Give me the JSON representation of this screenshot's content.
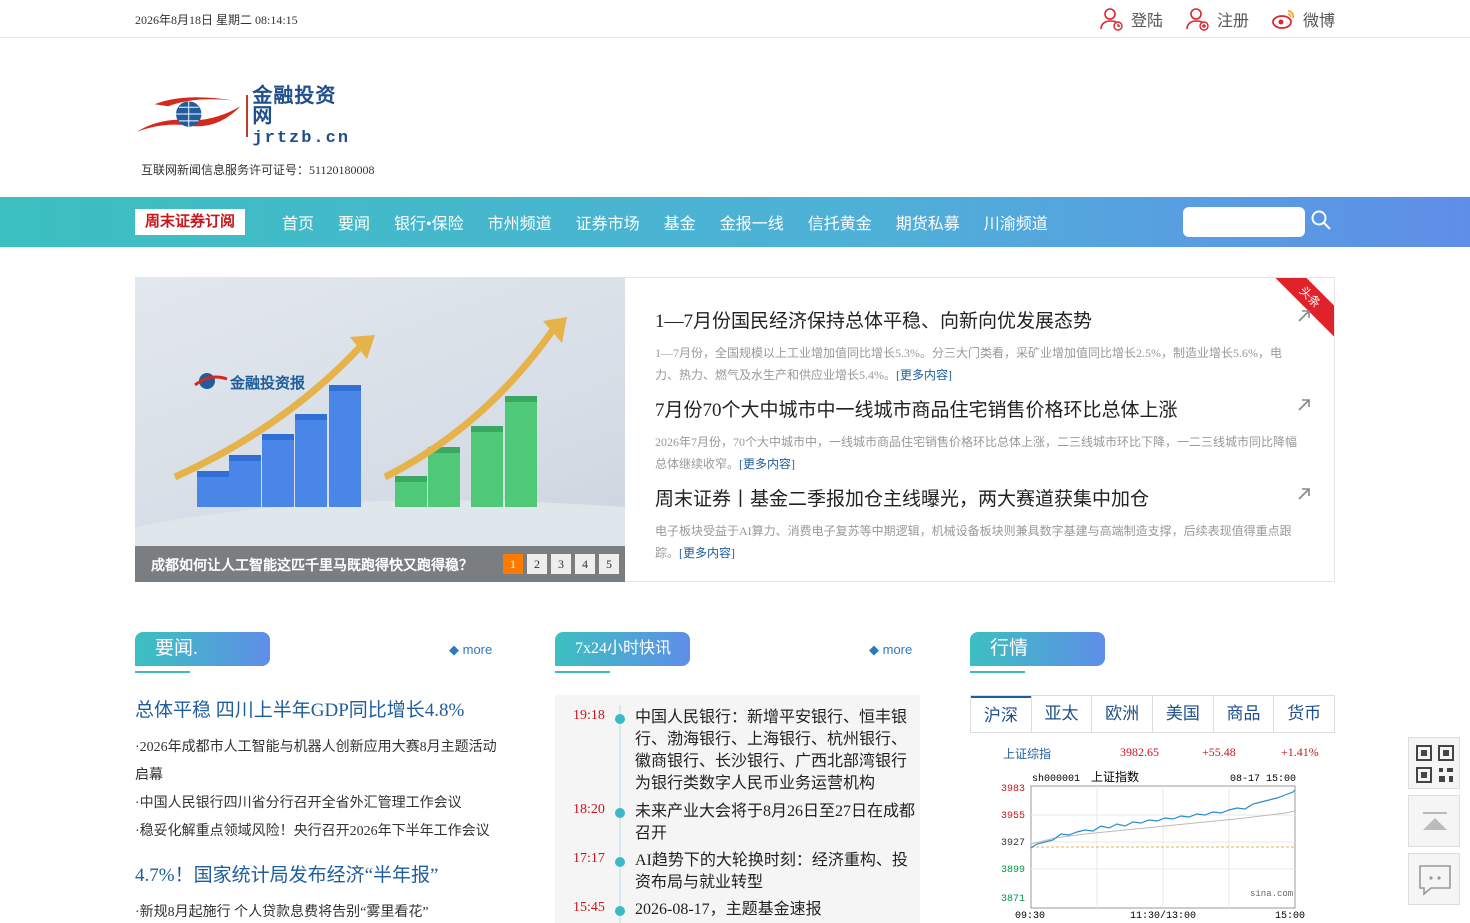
{
  "topbar": {
    "datetime": "2026年8月18日 星期二 08:14:15",
    "login": "登陆",
    "register": "注册",
    "weibo": "微博"
  },
  "logo": {
    "cn": "金融投资网",
    "en": "jrtzb.cn"
  },
  "license": "互联网新闻信息服务许可证号：51120180008",
  "nav": {
    "subscribe": "周末证券订阅",
    "items": [
      "首页",
      "要闻",
      "银行•保险",
      "市州频道",
      "证券市场",
      "基金",
      "金报一线",
      "信托黄金",
      "期货私募",
      "川渝频道"
    ],
    "search_placeholder": ""
  },
  "slider": {
    "watermark": "金融投资报",
    "caption": "成都如何让人工智能这匹千里马既跑得快又跑得稳？",
    "pages": [
      "1",
      "2",
      "3",
      "4",
      "5"
    ],
    "active": 1
  },
  "headlines": {
    "badge": "头条",
    "items": [
      {
        "title": "1—7月份国民经济保持总体平稳、向新向优发展态势",
        "desc": "1—7月份，全国规模以上工业增加值同比增长5.3%。分三大门类看，采矿业增加值同比增长2.5%，制造业增长5.6%，电力、热力、燃气及水生产和供应业增长5.4%。",
        "more": "[更多内容]"
      },
      {
        "title": "7月份70个大中城市中一线城市商品住宅销售价格环比总体上涨",
        "desc": "2026年7月份，70个大中城市中，一线城市商品住宅销售价格环比总体上涨，二三线城市环比下降，一二三线城市同比降幅总体继续收窄。",
        "more": "[更多内容]"
      },
      {
        "title": "周末证券丨基金二季报加仓主线曝光，两大赛道获集中加仓",
        "desc": "电子板块受益于AI算力、消费电子复苏等中期逻辑，机械设备板块则兼具数字基建与高端制造支撑，后续表现值得重点跟踪。",
        "more": "[更多内容]"
      }
    ]
  },
  "news": {
    "title": "要闻.",
    "more": "◆ more",
    "lead1": "总体平稳 四川上半年GDP同比增长4.8%",
    "items1": [
      "·2026年成都市人工智能与机器人创新应用大赛8月主题活动启幕",
      "·中国人民银行四川省分行召开全省外汇管理工作会议",
      "·稳妥化解重点领域风险！央行召开2026年下半年工作会议"
    ],
    "lead2": "4.7%！国家统计局发布经济“半年报”",
    "items2": [
      "·新规8月起施行 个人贷款息费将告别“雾里看花”"
    ]
  },
  "flash": {
    "title": "7x24小时快讯",
    "more": "◆ more",
    "items": [
      {
        "time": "19:18",
        "text": "中国人民银行：新增平安银行、恒丰银行、渤海银行、上海银行、杭州银行、徽商银行、长沙银行、广西北部湾银行为银行类数字人民币业务运营机构"
      },
      {
        "time": "18:20",
        "text": "未来产业大会将于8月26日至27日在成都召开"
      },
      {
        "time": "17:17",
        "text": "AI趋势下的大轮换时刻：经济重构、投资布局与就业转型"
      },
      {
        "time": "15:45",
        "text": "2026-08-17，主题基金速报"
      }
    ]
  },
  "market": {
    "title": "行情",
    "tabs": [
      "沪深",
      "亚太",
      "欧洲",
      "美国",
      "商品",
      "货币"
    ],
    "index": {
      "name": "上证综指",
      "value": "3982.65",
      "change": "+55.48",
      "pct": "+1.41%"
    },
    "chart": {
      "code": "sh000001",
      "name": "上证指数",
      "date": "08-17 15:00",
      "source": "sina.com",
      "y_ticks": [
        "3983",
        "3955",
        "3927",
        "3899",
        "3871"
      ],
      "x_ticks": [
        "09:30",
        "11:30/13:00",
        "15:00"
      ]
    }
  },
  "side": [
    "qr-code",
    "back-to-top",
    "feedback"
  ],
  "colors": {
    "accent": "#3cc0c0",
    "brand_blue": "#1f5d9c",
    "red": "#c8161d"
  }
}
